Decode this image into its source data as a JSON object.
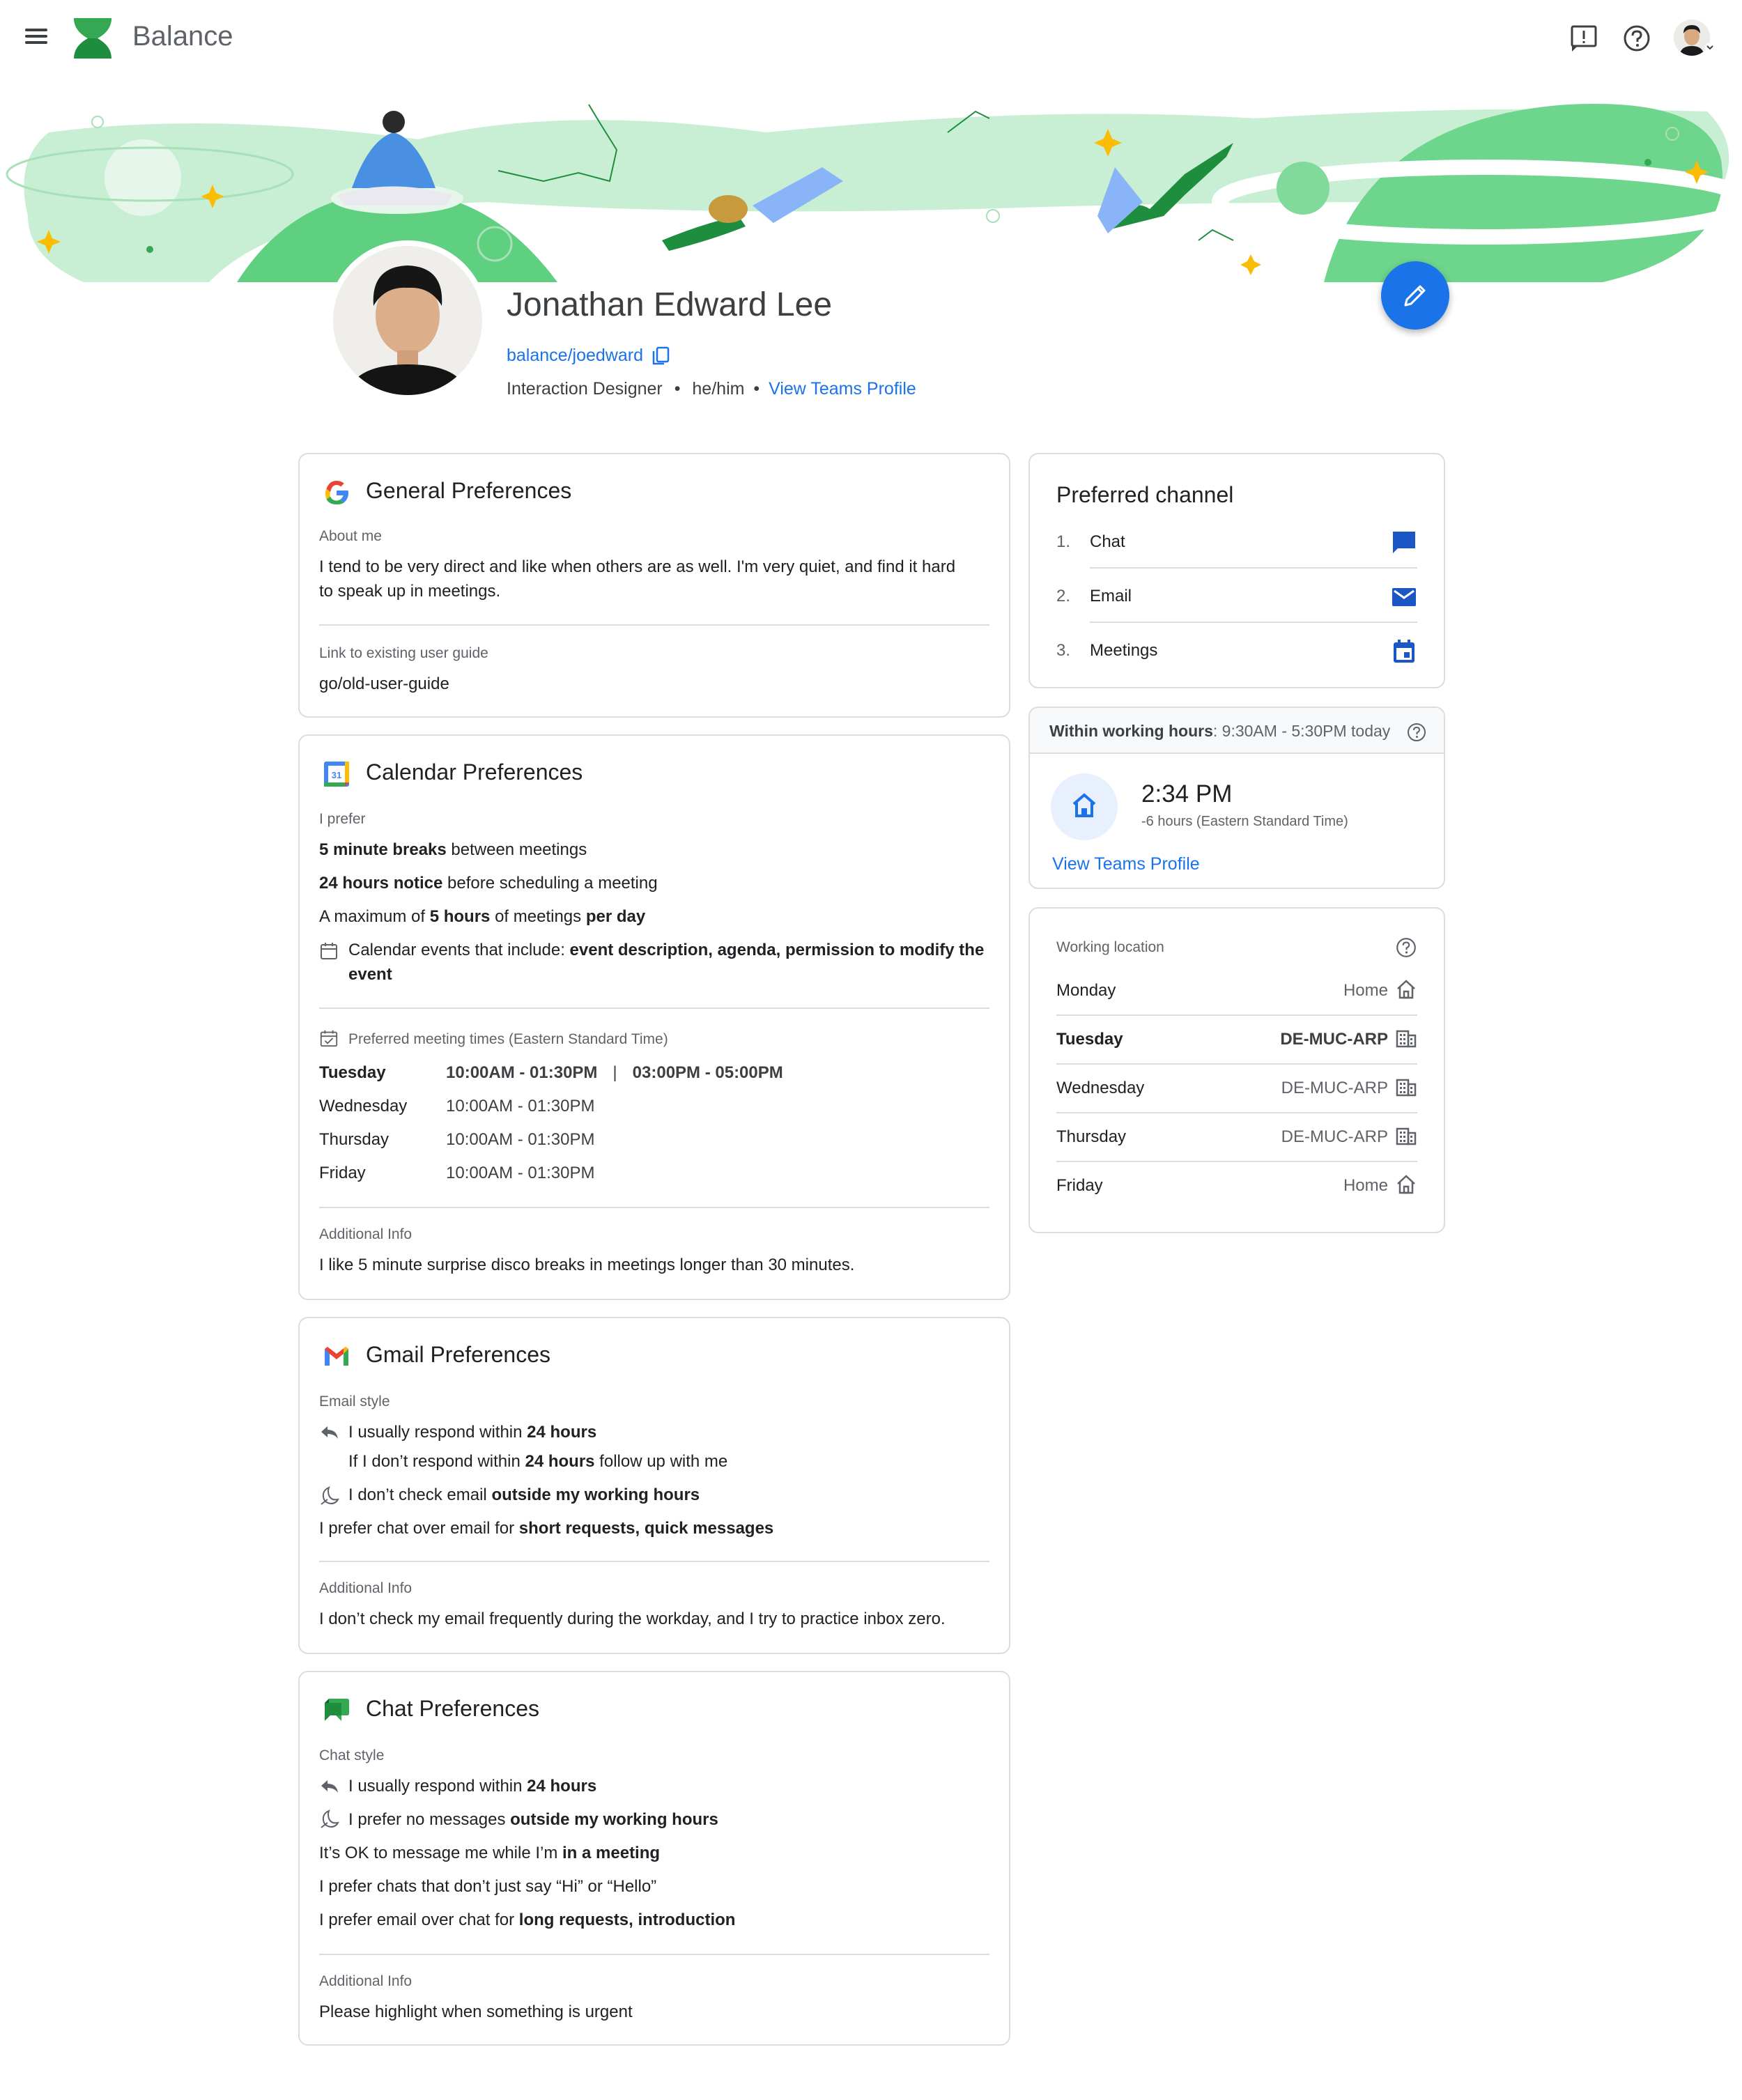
{
  "app": {
    "title": "Balance"
  },
  "profile": {
    "name": "Jonathan Edward Lee",
    "handle": "balance/joedward",
    "role": "Interaction Designer",
    "pronouns": "he/him",
    "sep": "•",
    "teams_link": "View Teams Profile"
  },
  "general": {
    "title": "General Preferences",
    "about_label": "About me",
    "about_line1": "I tend to be very direct and like when others are as well. I'm very quiet, and find it hard",
    "about_line2": "to speak up in meetings.",
    "guide_label": "Link to existing user guide",
    "guide_value": "go/old-user-guide"
  },
  "calendar": {
    "title": "Calendar Preferences",
    "icon_text": "31",
    "prefer_label": "I prefer",
    "p1_b": "5 minute breaks",
    "p1_r": " between meetings",
    "p2_b": "24 hours notice",
    "p2_r": " before scheduling a meeting",
    "p3_a": "A maximum of ",
    "p3_b": "5 hours",
    "p3_c": " of meetings ",
    "p3_d": "per day",
    "p4_a": "Calendar events that include: ",
    "p4_b1": "event description, agenda, permission to modify the",
    "p4_b2": "event",
    "times_label": "Preferred meeting times (Eastern Standard Time)",
    "times": [
      {
        "day": "Tuesday",
        "time": "10:00AM - 01:30PM",
        "sep": "|",
        "time2": "03:00PM - 05:00PM"
      },
      {
        "day": "Wednesday",
        "time": "10:00AM - 01:30PM"
      },
      {
        "day": "Thursday",
        "time": "10:00AM - 01:30PM"
      },
      {
        "day": "Friday",
        "time": "10:00AM - 01:30PM"
      }
    ],
    "add_label": "Additional Info",
    "add_value": "I like 5 minute surprise disco breaks in meetings longer than 30 minutes."
  },
  "gmail": {
    "title": "Gmail Preferences",
    "style_label": "Email style",
    "l1_a": "I usually respond within ",
    "l1_b": "24 hours",
    "l2_a": "If I don’t respond within ",
    "l2_b": "24 hours",
    "l2_c": " follow up with me",
    "l3_a": "I don’t check email ",
    "l3_b": "outside my working hours",
    "l4_a": "I prefer chat over email for ",
    "l4_b": "short requests, quick messages",
    "add_label": "Additional Info",
    "add_value": "I don’t check my email frequently during the workday, and I try to practice inbox zero."
  },
  "chat": {
    "title": "Chat Preferences",
    "style_label": "Chat style",
    "l1_a": "I usually respond within ",
    "l1_b": "24 hours",
    "l2_a": "I prefer no messages ",
    "l2_b": "outside my working hours",
    "l3_a": "It’s OK to message me while I’m ",
    "l3_b": "in a meeting",
    "l4_a": "I prefer chats that don’t just say “Hi” or “Hello”",
    "l5_a": "I prefer email over chat for ",
    "l5_b": "long requests, introduction",
    "add_label": "Additional Info",
    "add_value": "Please highlight when something is urgent"
  },
  "channel": {
    "title": "Preferred channel",
    "items": [
      {
        "num": "1.",
        "label": "Chat",
        "icon": "chat-icon"
      },
      {
        "num": "2.",
        "label": "Email",
        "icon": "mail-icon"
      },
      {
        "num": "3.",
        "label": "Meetings",
        "icon": "calendar-icon"
      }
    ]
  },
  "hours": {
    "label_b": "Within working hours",
    "label_r": ":  9:30AM - 5:30PM today",
    "time": "2:34 PM",
    "offset": "-6 hours (Eastern Standard Time)",
    "link": "View Teams Profile"
  },
  "location": {
    "label": "Working location",
    "rows": [
      {
        "day": "Monday",
        "loc": "Home",
        "icon": "home-icon"
      },
      {
        "day": "Tuesday",
        "loc": "DE-MUC-ARP",
        "icon": "building-icon"
      },
      {
        "day": "Wednesday",
        "loc": "DE-MUC-ARP",
        "icon": "building-icon"
      },
      {
        "day": "Thursday",
        "loc": "DE-MUC-ARP",
        "icon": "building-icon"
      },
      {
        "day": "Friday",
        "loc": "Home",
        "icon": "home-icon"
      }
    ]
  },
  "colors": {
    "accent": "#1a73e8",
    "brand_green": "#34a853",
    "banner_light": "#c8efd3"
  }
}
